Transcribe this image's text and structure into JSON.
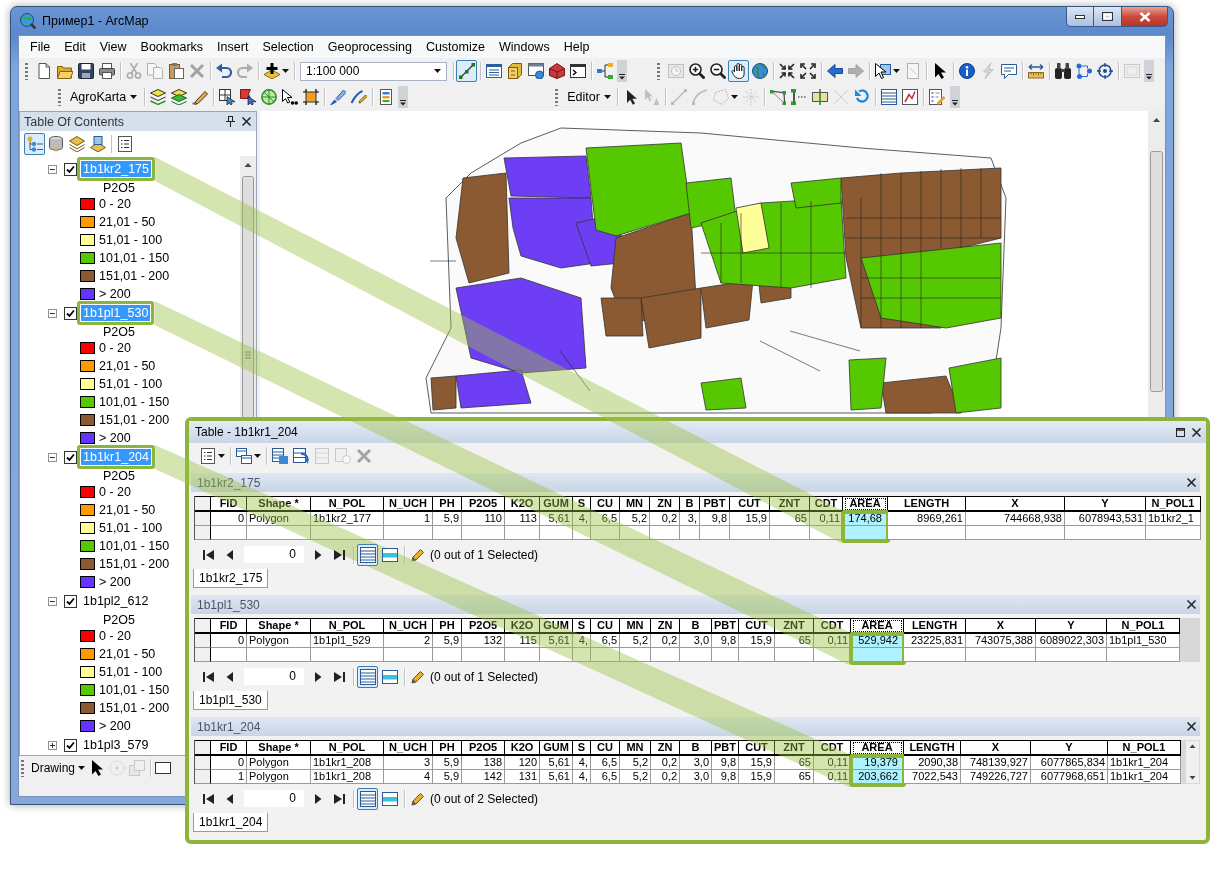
{
  "window": {
    "title": "Пример1 - ArcMap"
  },
  "menu": [
    "File",
    "Edit",
    "View",
    "Bookmarks",
    "Insert",
    "Selection",
    "Geoprocessing",
    "Customize",
    "Windows",
    "Help"
  ],
  "toolbars": [
    {
      "groups": [
        [
          {
            "kind": "button",
            "disabled": false,
            "pressed": false
          },
          {
            "kind": "button",
            "disabled": false,
            "pressed": false
          },
          {
            "kind": "button",
            "disabled": false,
            "pressed": false
          },
          {
            "kind": "button",
            "disabled": false,
            "pressed": false
          }
        ],
        [
          {
            "kind": "button",
            "disabled": true,
            "pressed": false
          },
          {
            "kind": "button",
            "disabled": true,
            "pressed": false
          },
          {
            "kind": "button",
            "disabled": false,
            "pressed": false
          },
          {
            "kind": "button",
            "disabled": true,
            "pressed": false
          }
        ],
        [
          {
            "kind": "button",
            "disabled": false,
            "pressed": false
          },
          {
            "kind": "button",
            "disabled": true,
            "pressed": false
          }
        ],
        [
          {
            "kind": "button",
            "disabled": false,
            "pressed": false
          }
        ],
        [
          {
            "kind": "combo",
            "value": "1:100 000"
          }
        ],
        [
          {
            "kind": "button",
            "disabled": false,
            "pressed": true
          }
        ],
        [
          {
            "kind": "button",
            "disabled": false,
            "pressed": false
          },
          {
            "kind": "button",
            "disabled": false,
            "pressed": false
          },
          {
            "kind": "button",
            "disabled": false,
            "pressed": false
          },
          {
            "kind": "button",
            "disabled": false,
            "pressed": false
          },
          {
            "kind": "button",
            "disabled": false,
            "pressed": false
          }
        ],
        [
          {
            "kind": "button",
            "disabled": false,
            "pressed": false
          }
        ]
      ]
    },
    {
      "groups": [
        [
          {
            "kind": "button",
            "disabled": true,
            "pressed": false
          },
          {
            "kind": "button",
            "disabled": false,
            "pressed": false
          },
          {
            "kind": "button",
            "disabled": false,
            "pressed": false
          },
          {
            "kind": "button",
            "disabled": false,
            "pressed": true
          },
          {
            "kind": "button",
            "disabled": false,
            "pressed": false
          }
        ],
        [
          {
            "kind": "button",
            "disabled": false,
            "pressed": false
          },
          {
            "kind": "button",
            "disabled": false,
            "pressed": false
          }
        ],
        [
          {
            "kind": "button",
            "disabled": false,
            "pressed": false
          },
          {
            "kind": "button",
            "disabled": true,
            "pressed": false
          }
        ],
        [
          {
            "kind": "button",
            "disabled": false,
            "pressed": false
          },
          {
            "kind": "button",
            "disabled": true,
            "pressed": false
          }
        ],
        [
          {
            "kind": "button",
            "disabled": false,
            "pressed": false
          }
        ],
        [
          {
            "kind": "button",
            "disabled": false,
            "pressed": false
          },
          {
            "kind": "button",
            "disabled": true,
            "pressed": false
          },
          {
            "kind": "button",
            "disabled": false,
            "pressed": false
          }
        ],
        [
          {
            "kind": "button",
            "disabled": false,
            "pressed": false
          }
        ],
        [
          {
            "kind": "button",
            "disabled": false,
            "pressed": false
          },
          {
            "kind": "button",
            "disabled": false,
            "pressed": false
          },
          {
            "kind": "button",
            "disabled": false,
            "pressed": false
          }
        ],
        [
          {
            "kind": "button",
            "disabled": true,
            "pressed": false
          }
        ]
      ]
    },
    {
      "groups": [
        [
          {
            "kind": "menu",
            "label": "AgroKarta"
          }
        ],
        [
          {
            "kind": "button",
            "disabled": false,
            "pressed": false
          },
          {
            "kind": "button",
            "disabled": false,
            "pressed": false
          },
          {
            "kind": "button",
            "disabled": false,
            "pressed": false
          }
        ],
        [
          {
            "kind": "button",
            "disabled": false,
            "pressed": false
          },
          {
            "kind": "button",
            "disabled": false,
            "pressed": false
          },
          {
            "kind": "button",
            "disabled": false,
            "pressed": false
          },
          {
            "kind": "button",
            "disabled": false,
            "pressed": false
          },
          {
            "kind": "button",
            "disabled": false,
            "pressed": false
          }
        ],
        [
          {
            "kind": "button",
            "disabled": false,
            "pressed": false
          },
          {
            "kind": "button",
            "disabled": false,
            "pressed": false
          }
        ],
        [
          {
            "kind": "button",
            "disabled": false,
            "pressed": false
          }
        ]
      ]
    },
    {
      "groups": [
        [
          {
            "kind": "menu",
            "label": "Editor"
          }
        ],
        [
          {
            "kind": "button",
            "disabled": false,
            "pressed": false
          },
          {
            "kind": "button",
            "disabled": true,
            "pressed": false
          }
        ],
        [
          {
            "kind": "button",
            "disabled": true,
            "pressed": false
          },
          {
            "kind": "button",
            "disabled": true,
            "pressed": false
          },
          {
            "kind": "button",
            "disabled": true,
            "pressed": false
          },
          {
            "kind": "button",
            "disabled": true,
            "pressed": false
          }
        ],
        [
          {
            "kind": "button",
            "disabled": false,
            "pressed": false
          },
          {
            "kind": "button",
            "disabled": false,
            "pressed": false
          },
          {
            "kind": "button",
            "disabled": false,
            "pressed": false
          },
          {
            "kind": "button",
            "disabled": true,
            "pressed": false
          },
          {
            "kind": "button",
            "disabled": false,
            "pressed": false
          }
        ],
        [
          {
            "kind": "button",
            "disabled": false,
            "pressed": false
          },
          {
            "kind": "button",
            "disabled": false,
            "pressed": false
          }
        ],
        [
          {
            "kind": "button",
            "disabled": false,
            "pressed": false
          }
        ]
      ]
    }
  ],
  "toc": {
    "title": "Table Of Contents",
    "views": [
      {
        "selected": true
      },
      {
        "selected": false
      },
      {
        "selected": false
      },
      {
        "selected": false
      },
      {
        "selected": false
      }
    ],
    "layers": [
      {
        "name": "1b1kr2_175",
        "checked": true,
        "expanded": true,
        "selected": true,
        "callout": true,
        "heading": "P2O5",
        "children": [
          {
            "label": "0 - 20",
            "color": "#ff0000"
          },
          {
            "label": "21,01 - 50",
            "color": "#ff9900"
          },
          {
            "label": "51,01 - 100",
            "color": "#ffff99"
          },
          {
            "label": "101,01 - 150",
            "color": "#55c800"
          },
          {
            "label": "151,01 - 200",
            "color": "#8b5a32"
          },
          {
            "label": "> 200",
            "color": "#6633ff"
          }
        ]
      },
      {
        "name": "1b1pl1_530",
        "checked": true,
        "expanded": true,
        "selected": true,
        "callout": true,
        "heading": "P2O5",
        "children": [
          {
            "label": "0 - 20",
            "color": "#ff0000"
          },
          {
            "label": "21,01 - 50",
            "color": "#ff9900"
          },
          {
            "label": "51,01 - 100",
            "color": "#ffff99"
          },
          {
            "label": "101,01 - 150",
            "color": "#55c800"
          },
          {
            "label": "151,01 - 200",
            "color": "#8b5a32"
          },
          {
            "label": "> 200",
            "color": "#6633ff"
          }
        ]
      },
      {
        "name": "1b1kr1_204",
        "checked": true,
        "expanded": true,
        "selected": true,
        "callout": true,
        "heading": "P2O5",
        "children": [
          {
            "label": "0 - 20",
            "color": "#ff0000"
          },
          {
            "label": "21,01 - 50",
            "color": "#ff9900"
          },
          {
            "label": "51,01 - 100",
            "color": "#ffff99"
          },
          {
            "label": "101,01 - 150",
            "color": "#55c800"
          },
          {
            "label": "151,01 - 200",
            "color": "#8b5a32"
          },
          {
            "label": "> 200",
            "color": "#6633ff"
          }
        ]
      },
      {
        "name": "1b1pl2_612",
        "checked": true,
        "expanded": true,
        "selected": false,
        "callout": false,
        "heading": "P2O5",
        "children": [
          {
            "label": "0 - 20",
            "color": "#ff0000"
          },
          {
            "label": "21,01 - 50",
            "color": "#ff9900"
          },
          {
            "label": "51,01 - 100",
            "color": "#ffff99"
          },
          {
            "label": "101,01 - 150",
            "color": "#55c800"
          },
          {
            "label": "151,01 - 200",
            "color": "#8b5a32"
          },
          {
            "label": "> 200",
            "color": "#6633ff"
          }
        ]
      },
      {
        "name": "1b1pl3_579",
        "checked": true,
        "expanded": false,
        "selected": false,
        "callout": false
      }
    ]
  },
  "drawing_toolbar": {
    "groups": [
      [
        {
          "kind": "menu",
          "label": "Drawing"
        },
        {
          "kind": "button",
          "disabled": false,
          "pressed": false
        },
        {
          "kind": "button",
          "disabled": true,
          "pressed": false
        },
        {
          "kind": "button",
          "disabled": true,
          "pressed": false
        }
      ],
      [
        {
          "kind": "button",
          "disabled": false,
          "pressed": false
        }
      ]
    ]
  },
  "table_window": {
    "title": "Table - 1b1kr1_204",
    "toolbar": {
      "groups": [
        [
          {
            "kind": "button",
            "disabled": false,
            "pressed": false
          }
        ],
        [
          {
            "kind": "button",
            "disabled": false,
            "pressed": false
          }
        ],
        [
          {
            "kind": "button",
            "disabled": false,
            "pressed": false
          },
          {
            "kind": "button",
            "disabled": false,
            "pressed": false
          },
          {
            "kind": "button",
            "disabled": true,
            "pressed": false
          },
          {
            "kind": "button",
            "disabled": true,
            "pressed": false
          },
          {
            "kind": "button",
            "disabled": true,
            "pressed": false
          }
        ]
      ]
    },
    "tables": [
      {
        "name": "1b1kr2_175",
        "columns": [
          {
            "label": "FID",
            "selected": false
          },
          {
            "label": "Shape *",
            "selected": false
          },
          {
            "label": "N_POL",
            "selected": false
          },
          {
            "label": "N_UCH",
            "selected": false
          },
          {
            "label": "PH",
            "selected": false
          },
          {
            "label": "P2O5",
            "selected": false
          },
          {
            "label": "K2O",
            "selected": false
          },
          {
            "label": "GUM",
            "selected": false
          },
          {
            "label": "S",
            "selected": false
          },
          {
            "label": "CU",
            "selected": false
          },
          {
            "label": "MN",
            "selected": false
          },
          {
            "label": "ZN",
            "selected": false
          },
          {
            "label": "B",
            "selected": false
          },
          {
            "label": "PBT",
            "selected": false
          },
          {
            "label": "CUT",
            "selected": false
          },
          {
            "label": "ZNT",
            "selected": false
          },
          {
            "label": "CDT",
            "selected": false
          },
          {
            "label": "AREA",
            "selected": true
          },
          {
            "label": "LENGTH",
            "selected": false
          },
          {
            "label": "X",
            "selected": false
          },
          {
            "label": "Y",
            "selected": false
          },
          {
            "label": "N_POL1",
            "selected": false
          }
        ],
        "rows": [
          [
            "0",
            "Polygon",
            "1b1kr2_177",
            "1",
            "5,9",
            "110",
            "113",
            "5,61",
            "4,",
            "6,5",
            "5,2",
            "0,2",
            "3,",
            "9,8",
            "15,9",
            "65",
            "0,11",
            "174,68",
            "8969,261",
            "744668,938",
            "6078943,531",
            "1b1kr2_1"
          ]
        ],
        "record": "0",
        "views": [
          {
            "selected": true
          },
          {
            "selected": false
          }
        ],
        "status": "(0 out of 1 Selected)",
        "tabs": [
          {
            "label": "1b1kr2_175",
            "selected": true
          }
        ]
      },
      {
        "name": "1b1pl1_530",
        "columns": [
          {
            "label": "FID",
            "selected": false
          },
          {
            "label": "Shape *",
            "selected": false
          },
          {
            "label": "N_POL",
            "selected": false
          },
          {
            "label": "N_UCH",
            "selected": false
          },
          {
            "label": "PH",
            "selected": false
          },
          {
            "label": "P2O5",
            "selected": false
          },
          {
            "label": "K2O",
            "selected": false
          },
          {
            "label": "GUM",
            "selected": false
          },
          {
            "label": "S",
            "selected": false
          },
          {
            "label": "CU",
            "selected": false
          },
          {
            "label": "MN",
            "selected": false
          },
          {
            "label": "ZN",
            "selected": false
          },
          {
            "label": "B",
            "selected": false
          },
          {
            "label": "PBT",
            "selected": false
          },
          {
            "label": "CUT",
            "selected": false
          },
          {
            "label": "ZNT",
            "selected": false
          },
          {
            "label": "CDT",
            "selected": false
          },
          {
            "label": "AREA",
            "selected": true
          },
          {
            "label": "LENGTH",
            "selected": false
          },
          {
            "label": "X",
            "selected": false
          },
          {
            "label": "Y",
            "selected": false
          },
          {
            "label": "N_POL1",
            "selected": false
          }
        ],
        "rows": [
          [
            "0",
            "Polygon",
            "1b1pl1_529",
            "2",
            "5,9",
            "132",
            "115",
            "5,61",
            "4,",
            "6,5",
            "5,2",
            "0,2",
            "3,0",
            "9,8",
            "15,9",
            "65",
            "0,11",
            "529,942",
            "23225,831",
            "743075,388",
            "6089022,303",
            "1b1pl1_530"
          ]
        ],
        "record": "0",
        "views": [
          {
            "selected": true
          },
          {
            "selected": false
          }
        ],
        "status": "(0 out of 1 Selected)",
        "tabs": [
          {
            "label": "1b1pl1_530",
            "selected": true
          }
        ]
      },
      {
        "name": "1b1kr1_204",
        "columns": [
          {
            "label": "FID",
            "selected": false
          },
          {
            "label": "Shape *",
            "selected": false
          },
          {
            "label": "N_POL",
            "selected": false
          },
          {
            "label": "N_UCH",
            "selected": false
          },
          {
            "label": "PH",
            "selected": false
          },
          {
            "label": "P2O5",
            "selected": false
          },
          {
            "label": "K2O",
            "selected": false
          },
          {
            "label": "GUM",
            "selected": false
          },
          {
            "label": "S",
            "selected": false
          },
          {
            "label": "CU",
            "selected": false
          },
          {
            "label": "MN",
            "selected": false
          },
          {
            "label": "ZN",
            "selected": false
          },
          {
            "label": "B",
            "selected": false
          },
          {
            "label": "PBT",
            "selected": false
          },
          {
            "label": "CUT",
            "selected": false
          },
          {
            "label": "ZNT",
            "selected": false
          },
          {
            "label": "CDT",
            "selected": false
          },
          {
            "label": "AREA",
            "selected": true
          },
          {
            "label": "LENGTH",
            "selected": false
          },
          {
            "label": "X",
            "selected": false
          },
          {
            "label": "Y",
            "selected": false
          },
          {
            "label": "N_POL1",
            "selected": false
          }
        ],
        "rows": [
          [
            "0",
            "Polygon",
            "1b1kr1_208",
            "3",
            "5,9",
            "138",
            "120",
            "5,61",
            "4,",
            "6,5",
            "5,2",
            "0,2",
            "3,0",
            "9,8",
            "15,9",
            "65",
            "0,11",
            "19,379",
            "2090,38",
            "748139,927",
            "6077865,834",
            "1b1kr1_204"
          ],
          [
            "1",
            "Polygon",
            "1b1kr1_208",
            "4",
            "5,9",
            "142",
            "131",
            "5,61",
            "4,",
            "6,5",
            "5,2",
            "0,2",
            "3,0",
            "9,8",
            "15,9",
            "65",
            "0,11",
            "203,662",
            "7022,543",
            "749226,727",
            "6077968,651",
            "1b1kr1_204"
          ]
        ],
        "record": "0",
        "views": [
          {
            "selected": true
          },
          {
            "selected": false
          }
        ],
        "status": "(0 out of 2 Selected)",
        "tabs": [
          {
            "label": "1b1kr1_204",
            "selected": true
          }
        ]
      }
    ]
  }
}
